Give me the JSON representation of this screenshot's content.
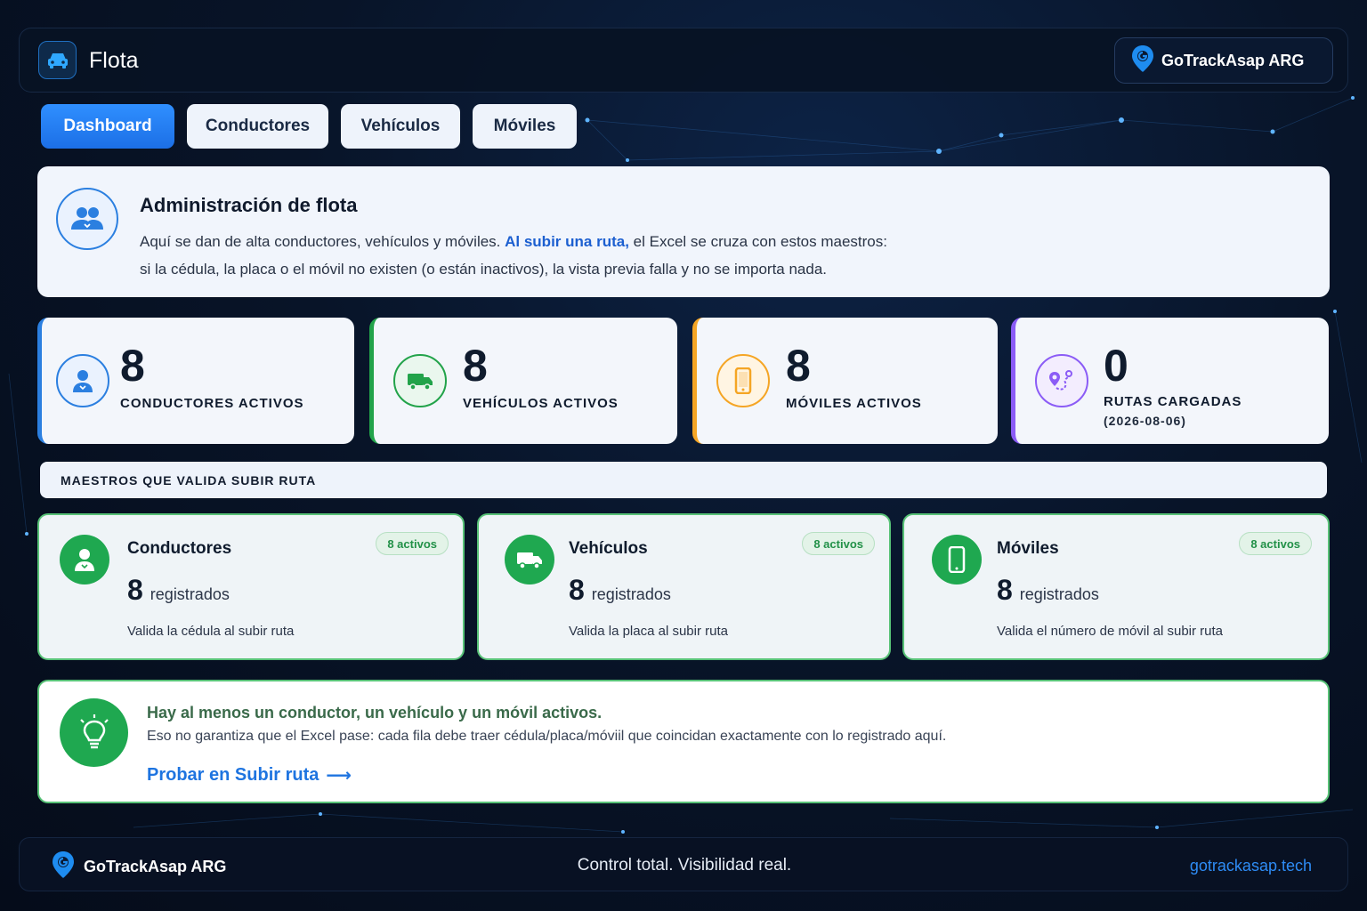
{
  "header": {
    "app_icon": "car-icon",
    "title": "Flota",
    "brand": "GoTrackAsap ARG",
    "brand_icon": "location-pin-icon"
  },
  "tabs": [
    {
      "label": "Dashboard",
      "active": true
    },
    {
      "label": "Conductores",
      "active": false
    },
    {
      "label": "Vehículos",
      "active": false
    },
    {
      "label": "Móviles",
      "active": false
    }
  ],
  "info": {
    "icon": "users-icon",
    "title": "Administración de flota",
    "line1_pre": "Aquí se dan de alta conductores, vehículos y móviles. ",
    "line1_highlight": "Al subir una ruta,",
    "line1_post": " el Excel se cruza con estos maestros:",
    "line2": "si la cédula, la placa o el móvil no existen (o están inactivos), la vista previa falla y no se importa nada."
  },
  "stats": [
    {
      "value": "8",
      "label": "CONDUCTORES ACTIVOS",
      "sub": "",
      "icon": "user-icon",
      "color": "#2b7fe0"
    },
    {
      "value": "8",
      "label": "VEHÍCULOS ACTIVOS",
      "sub": "",
      "icon": "truck-icon",
      "color": "#22a34a"
    },
    {
      "value": "8",
      "label": "MÓVILES ACTIVOS",
      "sub": "",
      "icon": "phone-icon",
      "color": "#f5a524"
    },
    {
      "value": "0",
      "label": "RUTAS CARGADAS",
      "sub": "(2026-08-06)",
      "icon": "route-icon",
      "color": "#8b5cf6"
    }
  ],
  "section_title": "MAESTROS QUE VALIDA SUBIR RUTA",
  "masters": [
    {
      "title": "Conductores",
      "count": "8",
      "unit": "registrados",
      "badge": "8 activos",
      "desc": "Valida la cédula al subir ruta",
      "icon": "user-icon"
    },
    {
      "title": "Vehículos",
      "count": "8",
      "unit": "registrados",
      "badge": "8 activos",
      "desc": "Valida la placa al subir ruta",
      "icon": "truck-icon"
    },
    {
      "title": "Móviles",
      "count": "8",
      "unit": "registrados",
      "badge": "8 activos",
      "desc": "Valida el número de móvil al subir ruta",
      "icon": "phone-icon"
    }
  ],
  "tip": {
    "icon": "lightbulb-icon",
    "title": "Hay al menos un conductor, un vehículo y un móvil activos.",
    "text": "Eso no garantiza que el Excel pase: cada fila debe traer cédula/placa/móviil que coincidan exactamente con lo registrado aquí.",
    "link": "Probar en Subir ruta",
    "link_arrow": "⟶"
  },
  "footer": {
    "brand": "GoTrackAsap ARG",
    "tagline": "Control total. Visibilidad real.",
    "link": "gotrackasap.tech"
  },
  "colors": {
    "accent": "#2b7fe0",
    "success": "#1fa850",
    "warning": "#f5a524",
    "purple": "#8b5cf6",
    "background": "#081428"
  }
}
